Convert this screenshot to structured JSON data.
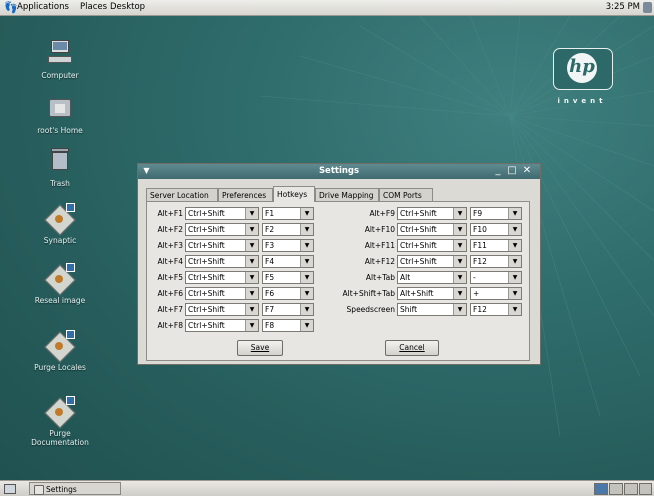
{
  "top_panel": {
    "menus": [
      "Applications",
      "Places",
      "Desktop"
    ],
    "clock": "3:25 PM"
  },
  "desktop": {
    "icons": [
      {
        "label": "Computer",
        "icon": "computer-icon"
      },
      {
        "label": "root's Home",
        "icon": "home-folder-icon"
      },
      {
        "label": "Trash",
        "icon": "trash-icon"
      },
      {
        "label": "Synaptic",
        "icon": "synaptic-icon"
      },
      {
        "label": "Reseal image",
        "icon": "reseal-icon"
      },
      {
        "label": "Purge Locales",
        "icon": "purge-icon"
      },
      {
        "label": "Purge Documentation",
        "icon": "purge-doc-icon"
      }
    ],
    "logo": {
      "brand": "hp",
      "tagline": "invent"
    }
  },
  "dialog": {
    "title": "Settings",
    "tabs": [
      "Server Location",
      "Preferences",
      "Hotkeys",
      "Drive Mapping",
      "COM Ports"
    ],
    "active_tab": "Hotkeys",
    "left_rows": [
      {
        "label": "Alt+F1",
        "modifier": "Ctrl+Shift",
        "key": "F1"
      },
      {
        "label": "Alt+F2",
        "modifier": "Ctrl+Shift",
        "key": "F2"
      },
      {
        "label": "Alt+F3",
        "modifier": "Ctrl+Shift",
        "key": "F3"
      },
      {
        "label": "Alt+F4",
        "modifier": "Ctrl+Shift",
        "key": "F4"
      },
      {
        "label": "Alt+F5",
        "modifier": "Ctrl+Shift",
        "key": "F5"
      },
      {
        "label": "Alt+F6",
        "modifier": "Ctrl+Shift",
        "key": "F6"
      },
      {
        "label": "Alt+F7",
        "modifier": "Ctrl+Shift",
        "key": "F7"
      },
      {
        "label": "Alt+F8",
        "modifier": "Ctrl+Shift",
        "key": "F8"
      }
    ],
    "right_rows": [
      {
        "label": "Alt+F9",
        "modifier": "Ctrl+Shift",
        "key": "F9"
      },
      {
        "label": "Alt+F10",
        "modifier": "Ctrl+Shift",
        "key": "F10"
      },
      {
        "label": "Alt+F11",
        "modifier": "Ctrl+Shift",
        "key": "F11"
      },
      {
        "label": "Alt+F12",
        "modifier": "Ctrl+Shift",
        "key": "F12"
      },
      {
        "label": "Alt+Tab",
        "modifier": "Alt",
        "key": "-"
      },
      {
        "label": "Alt+Shift+Tab",
        "modifier": "Alt+Shift",
        "key": "+"
      },
      {
        "label": "Speedscreen",
        "modifier": "Shift",
        "key": "F12"
      }
    ],
    "save_label": "Save",
    "cancel_label": "Cancel"
  },
  "bottom_panel": {
    "task_label": "Settings"
  },
  "colors": {
    "desktop": "#2f6d6c",
    "titlebar": "#4f7b80",
    "dialog_bg": "#dcdad5"
  }
}
